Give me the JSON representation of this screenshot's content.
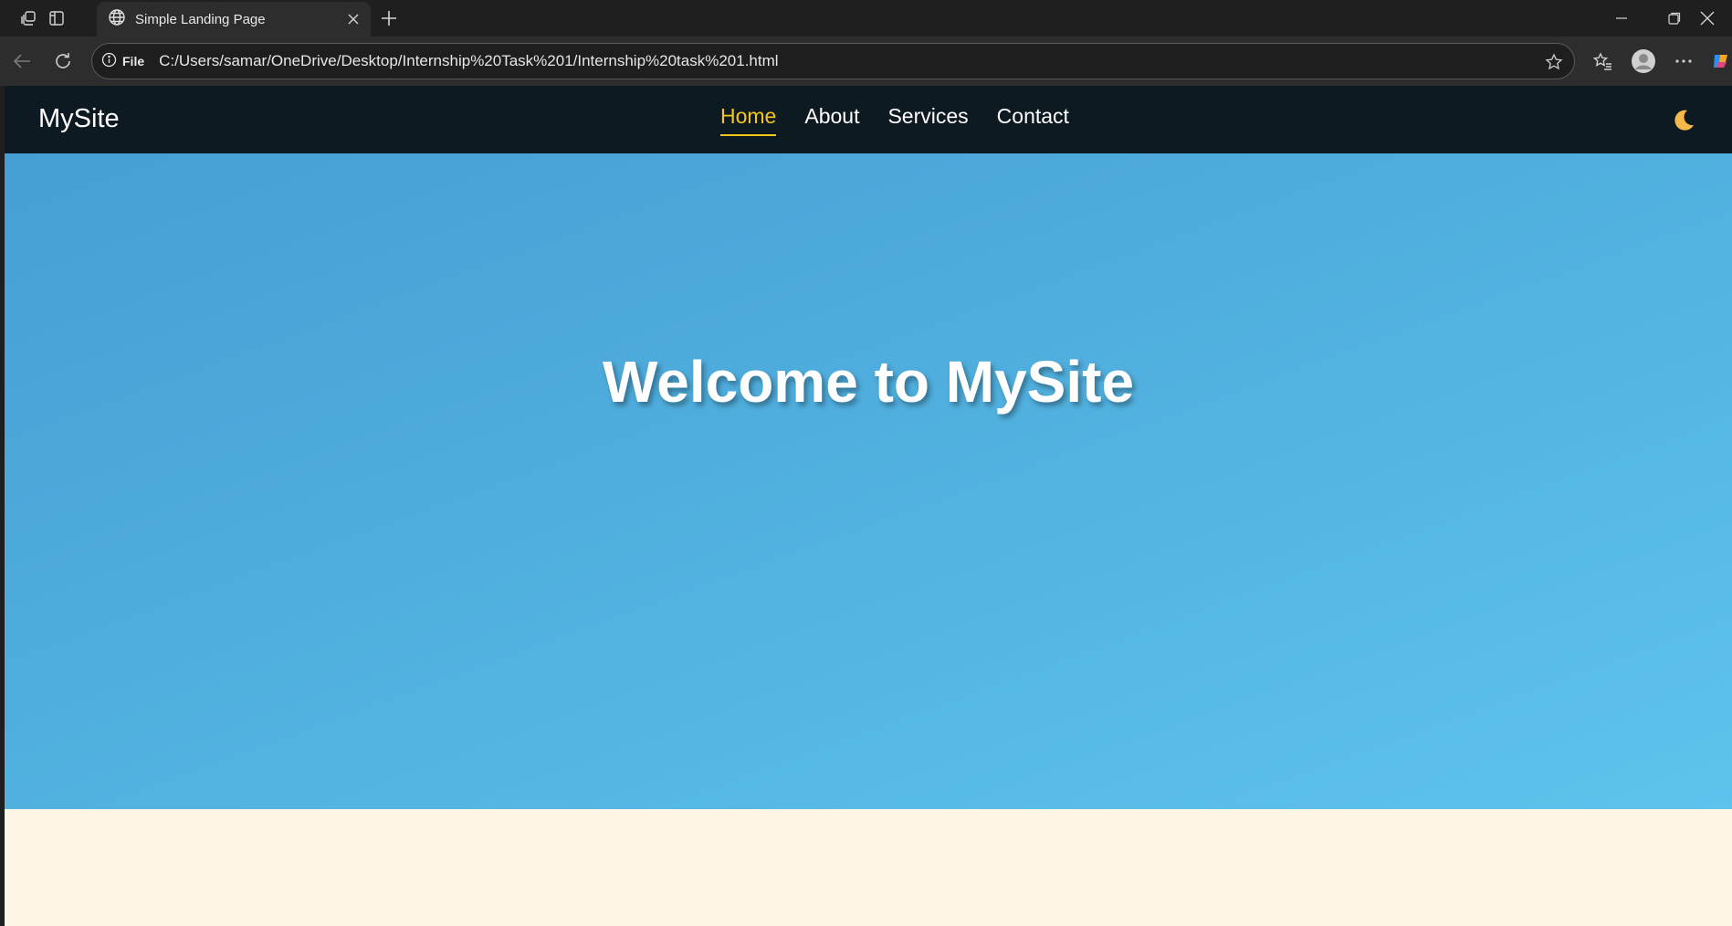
{
  "browser": {
    "tab_title": "Simple Landing Page",
    "site_info_label": "File",
    "url": "C:/Users/samar/OneDrive/Desktop/Internship%20Task%201/Internship%20task%201.html"
  },
  "site": {
    "brand": "MySite",
    "nav": [
      {
        "label": "Home",
        "active": true
      },
      {
        "label": "About",
        "active": false
      },
      {
        "label": "Services",
        "active": false
      },
      {
        "label": "Contact",
        "active": false
      }
    ],
    "theme_toggle_icon": "moon-icon",
    "hero_title": "Welcome to MySite"
  },
  "colors": {
    "navbar_bg": "#0e1a22",
    "active_link": "#f5c518",
    "hero_gradient_start": "#459fd3",
    "hero_gradient_end": "#5fc3ec",
    "below_section_bg": "#fdf6e6"
  }
}
